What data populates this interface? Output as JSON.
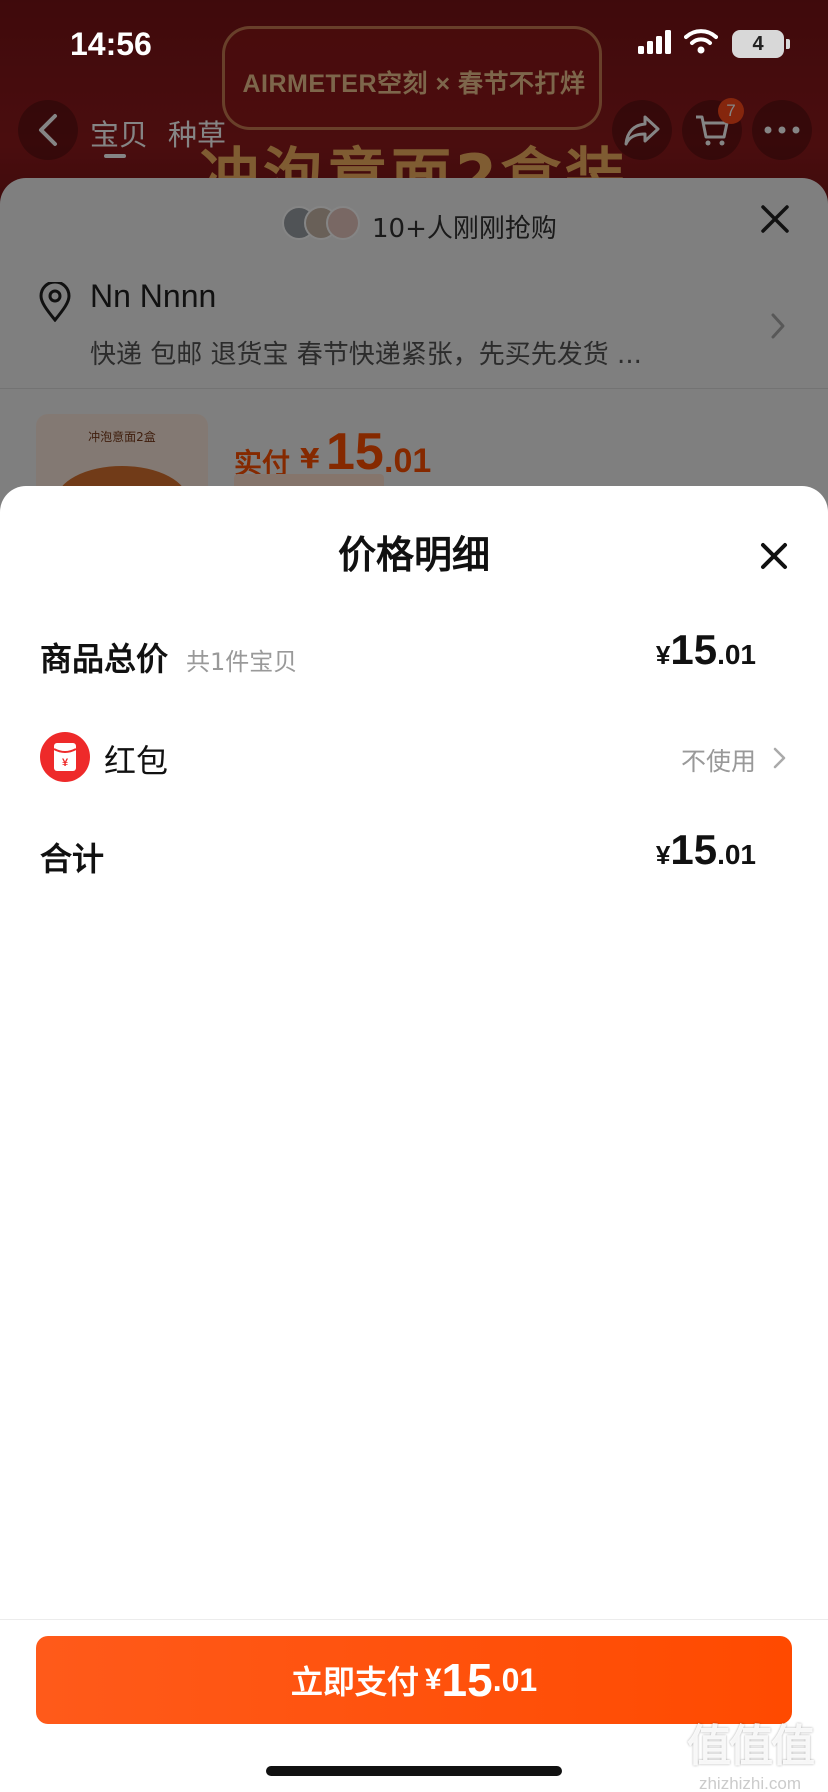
{
  "status_bar": {
    "time": "14:56",
    "battery": "4"
  },
  "background_page": {
    "brand_banner": "AIRMETER空刻 × 春节不打烊",
    "hero_text": "冲泡意面2盒装",
    "nav_tabs": [
      "宝贝",
      "种草"
    ],
    "cart_count": "7"
  },
  "order_sheet": {
    "buyers_text": "10+人刚刚抢购",
    "address_name": "Nn Nnnn",
    "address_detail": "快递 包邮 退货宝 春节快递紧张，先买先发货 ...",
    "product_thumb_label": "冲泡意面2盒",
    "price_label": "实付",
    "price_currency": "¥",
    "price_int": "15",
    "price_dec": ".01"
  },
  "price_detail": {
    "title": "价格明细",
    "products_label": "商品总价",
    "products_count": "共1件宝贝",
    "products_amount": {
      "currency": "¥",
      "int": "15",
      "dec": ".01"
    },
    "redpacket_label": "红包",
    "redpacket_value": "不使用",
    "total_label": "合计",
    "total_amount": {
      "currency": "¥",
      "int": "15",
      "dec": ".01"
    }
  },
  "pay_button": {
    "label": "立即支付",
    "currency": "¥",
    "int": "15",
    "dec": ".01"
  },
  "watermark": {
    "main": "值值值",
    "sub": "zhizhizhi.com"
  },
  "colors": {
    "accent": "#ff5000",
    "redpacket": "#ee2a2a",
    "hero": "#8f1a1c"
  }
}
